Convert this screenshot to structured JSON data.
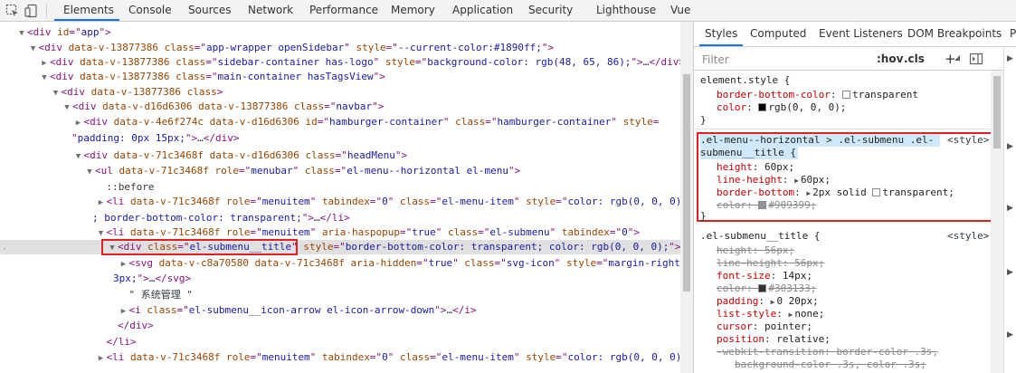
{
  "toolbar": {
    "tabs": [
      "Elements",
      "Console",
      "Sources",
      "Network",
      "Performance",
      "Memory",
      "Application",
      "Security",
      "Lighthouse",
      "Vue"
    ],
    "active_tab": "Elements"
  },
  "dom_lines": [
    {
      "indent": 0,
      "arrow": "▼",
      "html": [
        [
          "tag",
          "<div "
        ],
        [
          "an",
          "id"
        ],
        [
          "tag",
          "=\""
        ],
        [
          "av",
          "app"
        ],
        [
          "tag",
          "\">"
        ]
      ]
    },
    {
      "indent": 1,
      "arrow": "▼",
      "html": [
        [
          "tag",
          "<div "
        ],
        [
          "an",
          "data-v-13877386 class"
        ],
        [
          "tag",
          "=\""
        ],
        [
          "av",
          "app-wrapper openSidebar"
        ],
        [
          "tag",
          "\" "
        ],
        [
          "an",
          "style"
        ],
        [
          "tag",
          "=\""
        ],
        [
          "av",
          "--current-color:#1890ff;"
        ],
        [
          "tag",
          "\">"
        ]
      ]
    },
    {
      "indent": 2,
      "arrow": "▶",
      "html": [
        [
          "tag",
          "<div "
        ],
        [
          "an",
          "data-v-13877386 class"
        ],
        [
          "tag",
          "=\""
        ],
        [
          "av",
          "sidebar-container has-logo"
        ],
        [
          "tag",
          "\" "
        ],
        [
          "an",
          "style"
        ],
        [
          "tag",
          "=\""
        ],
        [
          "av",
          "background-color: rgb(48, 65, 86);"
        ],
        [
          "tag",
          "\">"
        ],
        [
          "txt",
          "…"
        ],
        [
          "tag",
          "</div>"
        ]
      ]
    },
    {
      "indent": 2,
      "arrow": "▼",
      "html": [
        [
          "tag",
          "<div "
        ],
        [
          "an",
          "data-v-13877386 class"
        ],
        [
          "tag",
          "=\""
        ],
        [
          "av",
          "main-container hasTagsView"
        ],
        [
          "tag",
          "\">"
        ]
      ]
    },
    {
      "indent": 3,
      "arrow": "▼",
      "html": [
        [
          "tag",
          "<div "
        ],
        [
          "an",
          "data-v-13877386 class"
        ],
        [
          "tag",
          ">"
        ]
      ]
    },
    {
      "indent": 4,
      "arrow": "▼",
      "html": [
        [
          "tag",
          "<div "
        ],
        [
          "an",
          "data-v-d16d6306 data-v-13877386 class"
        ],
        [
          "tag",
          "=\""
        ],
        [
          "av",
          "navbar"
        ],
        [
          "tag",
          "\">"
        ]
      ]
    },
    {
      "indent": 5,
      "arrow": "▶",
      "html": [
        [
          "tag",
          "<div "
        ],
        [
          "an",
          "data-v-4e6f274c data-v-d16d6306 id"
        ],
        [
          "tag",
          "=\""
        ],
        [
          "av",
          "hamburger-container"
        ],
        [
          "tag",
          "\" "
        ],
        [
          "an",
          "class"
        ],
        [
          "tag",
          "=\""
        ],
        [
          "av",
          "hamburger-container"
        ],
        [
          "tag",
          "\" "
        ],
        [
          "an",
          "style"
        ],
        [
          "tag",
          "="
        ]
      ]
    },
    {
      "indent": 5,
      "arrow": "",
      "cont": true,
      "html": [
        [
          "tag",
          "\""
        ],
        [
          "av",
          "padding: 0px 15px;"
        ],
        [
          "tag",
          "\">"
        ],
        [
          "txt",
          "…"
        ],
        [
          "tag",
          "</div>"
        ]
      ]
    },
    {
      "indent": 5,
      "arrow": "▼",
      "html": [
        [
          "tag",
          "<div "
        ],
        [
          "an",
          "data-v-71c3468f data-v-d16d6306 class"
        ],
        [
          "tag",
          "=\""
        ],
        [
          "av",
          "headMenu"
        ],
        [
          "tag",
          "\">"
        ]
      ]
    },
    {
      "indent": 6,
      "arrow": "▼",
      "html": [
        [
          "tag",
          "<ul "
        ],
        [
          "an",
          "data-v-71c3468f role"
        ],
        [
          "tag",
          "=\""
        ],
        [
          "av",
          "menubar"
        ],
        [
          "tag",
          "\" "
        ],
        [
          "an",
          "class"
        ],
        [
          "tag",
          "=\""
        ],
        [
          "av",
          "el-menu--horizontal el-menu"
        ],
        [
          "tag",
          "\">"
        ]
      ]
    },
    {
      "indent": 7,
      "arrow": "",
      "html": [
        [
          "txt",
          "::before"
        ]
      ]
    },
    {
      "indent": 7,
      "arrow": "▶",
      "html": [
        [
          "tag",
          "<li "
        ],
        [
          "an",
          "data-v-71c3468f role"
        ],
        [
          "tag",
          "=\""
        ],
        [
          "av",
          "menuitem"
        ],
        [
          "tag",
          "\" "
        ],
        [
          "an",
          "tabindex"
        ],
        [
          "tag",
          "=\""
        ],
        [
          "av",
          "0"
        ],
        [
          "tag",
          "\" "
        ],
        [
          "an",
          "class"
        ],
        [
          "tag",
          "=\""
        ],
        [
          "av",
          "el-menu-item"
        ],
        [
          "tag",
          "\" "
        ],
        [
          "an",
          "style"
        ],
        [
          "tag",
          "=\""
        ],
        [
          "av",
          "color: rgb(0, 0, 0)"
        ]
      ]
    },
    {
      "indent": 7,
      "arrow": "",
      "wrap": true,
      "html": [
        [
          "av",
          "; border-bottom-color: transparent;"
        ],
        [
          "tag",
          "\">"
        ],
        [
          "txt",
          "…"
        ],
        [
          "tag",
          "</li>"
        ]
      ]
    },
    {
      "indent": 7,
      "arrow": "▼",
      "html": [
        [
          "tag",
          "<li "
        ],
        [
          "an",
          "data-v-71c3468f role"
        ],
        [
          "tag",
          "=\""
        ],
        [
          "av",
          "menuitem"
        ],
        [
          "tag",
          "\" "
        ],
        [
          "an",
          "aria-haspopup"
        ],
        [
          "tag",
          "=\""
        ],
        [
          "av",
          "true"
        ],
        [
          "tag",
          "\" "
        ],
        [
          "an",
          "class"
        ],
        [
          "tag",
          "=\""
        ],
        [
          "av",
          "el-submenu"
        ],
        [
          "tag",
          "\" "
        ],
        [
          "an",
          "tabindex"
        ],
        [
          "tag",
          "=\""
        ],
        [
          "av",
          "0"
        ],
        [
          "tag",
          "\">"
        ]
      ]
    },
    {
      "indent": 8,
      "arrow": "▼",
      "selected": true,
      "html": [
        [
          "tag",
          "<div "
        ],
        [
          "an",
          "class"
        ],
        [
          "tag",
          "=\""
        ],
        [
          "av",
          "el-submenu__title"
        ],
        [
          "tag",
          "\" "
        ],
        [
          "an",
          "style"
        ],
        [
          "tag",
          "=\""
        ],
        [
          "av",
          "border-bottom-color: transparent; color: rgb(0, 0, 0);"
        ],
        [
          "tag",
          "\">"
        ]
      ]
    },
    {
      "indent": 9,
      "arrow": "▶",
      "html": [
        [
          "tag",
          "<svg "
        ],
        [
          "an",
          "data-v-c8a70580 data-v-71c3468f aria-hidden"
        ],
        [
          "tag",
          "=\""
        ],
        [
          "av",
          "true"
        ],
        [
          "tag",
          "\" "
        ],
        [
          "an",
          "class"
        ],
        [
          "tag",
          "=\""
        ],
        [
          "av",
          "svg-icon"
        ],
        [
          "tag",
          "\" "
        ],
        [
          "an",
          "style"
        ],
        [
          "tag",
          "=\""
        ],
        [
          "av",
          "margin-right:"
        ]
      ]
    },
    {
      "indent": 9,
      "arrow": "",
      "wrap": true,
      "html": [
        [
          "av",
          "3px;"
        ],
        [
          "tag",
          "\">"
        ],
        [
          "txt",
          "…"
        ],
        [
          "tag",
          "</svg>"
        ]
      ]
    },
    {
      "indent": 9,
      "arrow": "",
      "html": [
        [
          "txt",
          "\" 系统管理 \""
        ]
      ]
    },
    {
      "indent": 9,
      "arrow": "▶",
      "html": [
        [
          "tag",
          "<i "
        ],
        [
          "an",
          "class"
        ],
        [
          "tag",
          "=\""
        ],
        [
          "av",
          "el-submenu__icon-arrow el-icon-arrow-down"
        ],
        [
          "tag",
          "\">"
        ],
        [
          "txt",
          "…"
        ],
        [
          "tag",
          "</i>"
        ]
      ]
    },
    {
      "indent": 8,
      "arrow": "",
      "html": [
        [
          "tag",
          "</div>"
        ]
      ]
    },
    {
      "indent": 7,
      "arrow": "",
      "html": [
        [
          "tag",
          "</li>"
        ]
      ]
    },
    {
      "indent": 7,
      "arrow": "▶",
      "html": [
        [
          "tag",
          "<li "
        ],
        [
          "an",
          "data-v-71c3468f role"
        ],
        [
          "tag",
          "=\""
        ],
        [
          "av",
          "menuitem"
        ],
        [
          "tag",
          "\" "
        ],
        [
          "an",
          "tabindex"
        ],
        [
          "tag",
          "=\""
        ],
        [
          "av",
          "0"
        ],
        [
          "tag",
          "\" "
        ],
        [
          "an",
          "class"
        ],
        [
          "tag",
          "=\""
        ],
        [
          "av",
          "el-menu-item"
        ],
        [
          "tag",
          "\" "
        ],
        [
          "an",
          "style"
        ],
        [
          "tag",
          "=\""
        ],
        [
          "av",
          "color: rgb(0, 0, 0)"
        ]
      ]
    }
  ],
  "styles_panel": {
    "tabs": [
      "Styles",
      "Computed",
      "Event Listeners",
      "DOM Breakpoints",
      "P"
    ],
    "active_tab": "Styles",
    "filter_placeholder": "Filter",
    "hov_label": ":hov",
    "cls_label": ".cls",
    "plus_label": "+",
    "element_style": {
      "selector": "element.style {",
      "props": [
        {
          "name": "border-bottom-color",
          "value": "transparent",
          "swatch": "#ffffff"
        },
        {
          "name": "color",
          "value": "rgb(0, 0, 0);",
          "swatch": "#000000"
        }
      ],
      "close": "}"
    },
    "highlighted_rule": {
      "selector_line1": ".el-menu--horizontal > .el-submenu .el-",
      "selector_line2": "submenu__title {",
      "source": "<style>",
      "props": [
        {
          "name": "height",
          "value": "60px;"
        },
        {
          "name": "line-height",
          "value": "60px;",
          "arrow": true
        },
        {
          "name": "border-bottom",
          "value": "2px solid",
          "arrow": true,
          "swatch": "#ffffff",
          "value2": "transparent;"
        },
        {
          "name": "color",
          "value": "#909399;",
          "strike": true,
          "swatch": "#909399"
        }
      ],
      "close": "}"
    },
    "base_rule": {
      "selector": ".el-submenu__title {",
      "source": "<style>",
      "props": [
        {
          "name": "height",
          "value": "56px;",
          "strike": true
        },
        {
          "name": "line-height",
          "value": "56px;",
          "strike": true
        },
        {
          "name": "font-size",
          "value": "14px;"
        },
        {
          "name": "color",
          "value": "#303133;",
          "strike": true,
          "swatch": "#303133"
        },
        {
          "name": "padding",
          "value": "0 20px;",
          "arrow": true
        },
        {
          "name": "list-style",
          "value": "none;",
          "arrow": true
        },
        {
          "name": "cursor",
          "value": "pointer;"
        },
        {
          "name": "position",
          "value": "relative;"
        },
        {
          "name": "-webkit-transition",
          "value": "border-color .3s,",
          "strike": true
        },
        {
          "name": "",
          "value": "background-color .3s, color .3s;",
          "strike": true,
          "indent": true
        }
      ]
    }
  },
  "colors": {
    "accent": "#1a73e8",
    "highlight_border": "#e02020",
    "selector_highlight": "#cfe8fc"
  }
}
